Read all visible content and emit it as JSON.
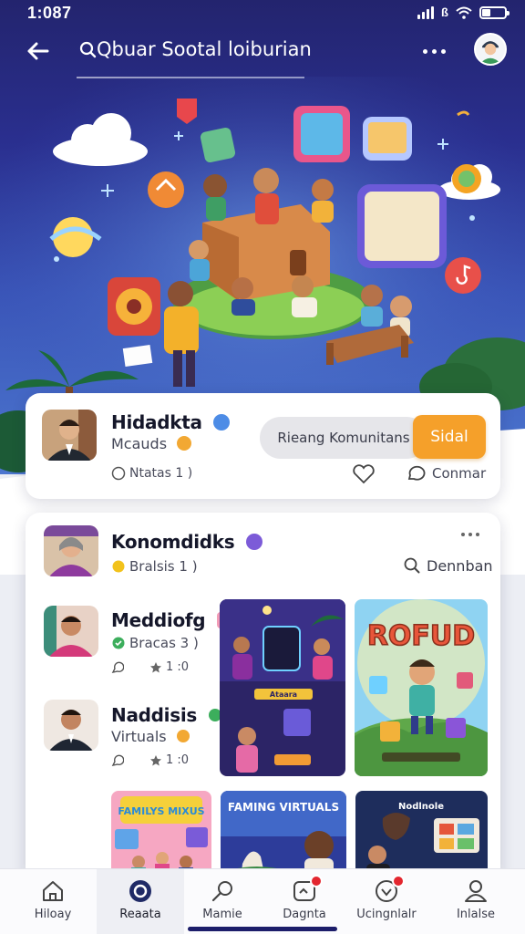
{
  "status": {
    "time": "1:087"
  },
  "header": {
    "search_text": "Qbuar Sootal loiburian"
  },
  "post_card": {
    "name": "Hidadkta",
    "subtitle": "Mcauds",
    "meta": "Ntatas 1 )",
    "secondary_button": "Rieang Komunitans",
    "primary_button": "Sidal",
    "comment_label": "Conmar",
    "accent_color": "#f5a02a"
  },
  "community_card": {
    "title": "Konomdidks",
    "subtitle": "Bralsis 1 )",
    "search_label": "Dennban",
    "members": [
      {
        "name": "Meddiofg",
        "meta": "Bracas 3 )",
        "stat": "1 :0"
      },
      {
        "name": "Naddisis",
        "meta": "Virtuals",
        "stat": "1 :0"
      }
    ],
    "thumbnails": [
      {
        "title": "Ataara",
        "icon": "night-tablet-learning"
      },
      {
        "title": "ROFUD",
        "icon": "kids-blocks-cartoon"
      },
      {
        "title": "FAMILYS MIXUS",
        "icon": "family-games"
      },
      {
        "title": "FAMING VIRTUALS",
        "icon": "virtual-family"
      },
      {
        "title": "Nodlnole",
        "icon": "dark-media-board"
      }
    ]
  },
  "bottom_nav": [
    {
      "label": "Hiloay",
      "icon": "home-icon",
      "active": false,
      "badge": false
    },
    {
      "label": "Reaata",
      "icon": "record-icon",
      "active": true,
      "badge": false
    },
    {
      "label": "Mamie",
      "icon": "search-icon",
      "active": false,
      "badge": false
    },
    {
      "label": "Dagnta",
      "icon": "tools-icon",
      "active": false,
      "badge": true
    },
    {
      "label": "Ucingnlalr",
      "icon": "heart-icon",
      "active": false,
      "badge": true
    },
    {
      "label": "Inlalse",
      "icon": "profile-icon",
      "active": false,
      "badge": false
    }
  ]
}
